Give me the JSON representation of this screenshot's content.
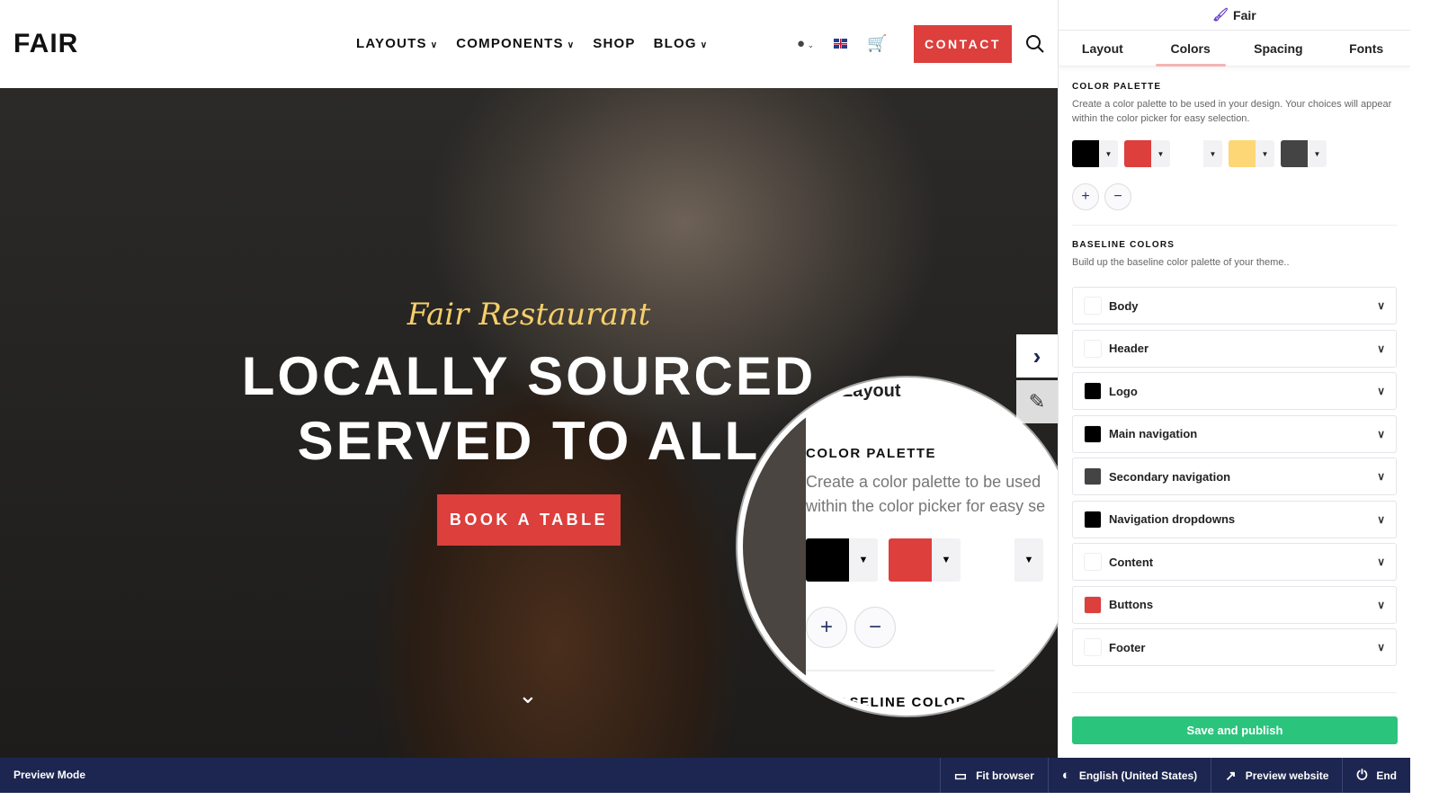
{
  "site": {
    "logo": "FAIR",
    "menu": [
      {
        "label": "LAYOUTS",
        "dropdown": true
      },
      {
        "label": "COMPONENTS",
        "dropdown": true
      },
      {
        "label": "SHOP",
        "dropdown": false
      },
      {
        "label": "BLOG",
        "dropdown": true
      }
    ],
    "contact": "CONTACT",
    "hero": {
      "script": "Fair Restaurant",
      "line1": "LOCALLY SOURCED",
      "line2": "SERVED TO ALL",
      "cta": "BOOK A TABLE"
    }
  },
  "magnifier": {
    "tab": "Layout",
    "heading": "COLOR PALETTE",
    "desc1": "Create a color palette to be used",
    "desc2": "within the color picker for easy se",
    "next": "BASELINE COLORS"
  },
  "panel": {
    "title": "Fair",
    "tabs": [
      "Layout",
      "Colors",
      "Spacing",
      "Fonts"
    ],
    "active_tab": "Colors",
    "palette": {
      "heading": "COLOR PALETTE",
      "desc": "Create a color palette to be used in your design. Your choices will appear within the color picker for easy selection.",
      "colors": [
        "#000000",
        "#dc3f3c",
        "#ffffff",
        "#fdd775",
        "#444444"
      ]
    },
    "baseline": {
      "heading": "BASELINE COLORS",
      "desc": "Build up the baseline color palette of your theme..",
      "items": [
        {
          "label": "Body",
          "color": "#ffffff"
        },
        {
          "label": "Header",
          "color": "#ffffff"
        },
        {
          "label": "Logo",
          "color": "#000000"
        },
        {
          "label": "Main navigation",
          "color": "#000000"
        },
        {
          "label": "Secondary navigation",
          "color": "#444444"
        },
        {
          "label": "Navigation dropdowns",
          "color": "#000000"
        },
        {
          "label": "Content",
          "color": "#ffffff"
        },
        {
          "label": "Buttons",
          "color": "#dc3f3c"
        },
        {
          "label": "Footer",
          "color": "#ffffff"
        }
      ]
    },
    "save": "Save and publish"
  },
  "bottom": {
    "mode": "Preview Mode",
    "items": [
      {
        "label": "Fit browser",
        "icon": "browser-icon"
      },
      {
        "label": "English (United States)",
        "icon": "globe-icon"
      },
      {
        "label": "Preview website",
        "icon": "external-link-icon"
      },
      {
        "label": "End",
        "icon": "power-icon"
      }
    ]
  }
}
